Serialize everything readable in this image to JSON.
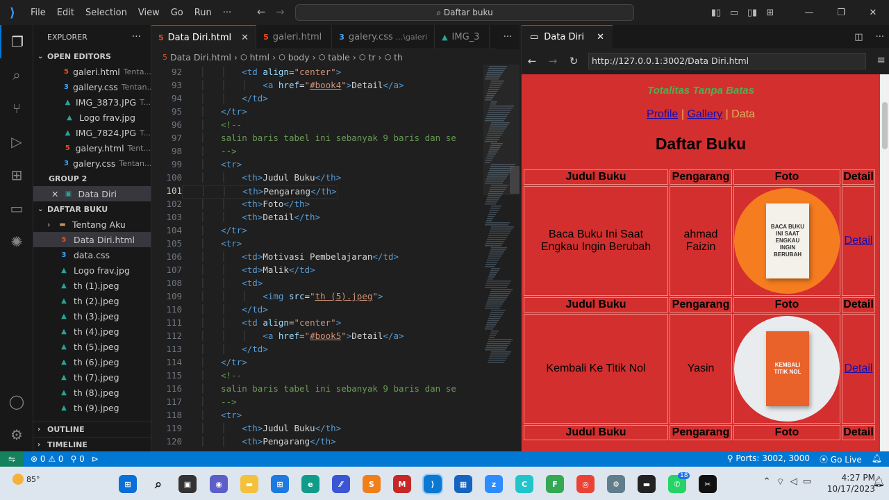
{
  "titlebar": {
    "menu": [
      "File",
      "Edit",
      "Selection",
      "View",
      "Go",
      "Run",
      "···"
    ],
    "search": "Daftar buku"
  },
  "sidebar": {
    "header": "EXPLORER",
    "open_editors_title": "OPEN EDITORS",
    "open_editors": [
      {
        "name": "galeri.html",
        "desc": "Tenta...",
        "type": "html"
      },
      {
        "name": "gallery.css",
        "desc": "Tentan...",
        "type": "css"
      },
      {
        "name": "IMG_3873.JPG",
        "desc": "T...",
        "type": "img"
      },
      {
        "name": "Logo frav.jpg",
        "desc": "",
        "type": "img"
      },
      {
        "name": "IMG_7824.JPG",
        "desc": "T...",
        "type": "img"
      },
      {
        "name": "galery.html",
        "desc": "Tent...",
        "type": "html"
      },
      {
        "name": "galery.css",
        "desc": "Tentan...",
        "type": "css"
      }
    ],
    "group2_title": "GROUP 2",
    "group2_item": "Data Diri",
    "folder_title": "DAFTAR BUKU",
    "folder_items": [
      {
        "name": "Tentang Aku",
        "type": "fold"
      },
      {
        "name": "Data Diri.html",
        "type": "html"
      },
      {
        "name": "data.css",
        "type": "css"
      },
      {
        "name": "Logo frav.jpg",
        "type": "img"
      },
      {
        "name": "th (1).jpeg",
        "type": "img"
      },
      {
        "name": "th (2).jpeg",
        "type": "img"
      },
      {
        "name": "th (3).jpeg",
        "type": "img"
      },
      {
        "name": "th (4).jpeg",
        "type": "img"
      },
      {
        "name": "th (5).jpeg",
        "type": "img"
      },
      {
        "name": "th (6).jpeg",
        "type": "img"
      },
      {
        "name": "th (7).jpeg",
        "type": "img"
      },
      {
        "name": "th (8).jpeg",
        "type": "img"
      },
      {
        "name": "th (9).jpeg",
        "type": "img"
      }
    ],
    "outline": "OUTLINE",
    "timeline": "TIMELINE"
  },
  "editor": {
    "tabs": [
      {
        "label": "Data Diri.html",
        "desc": "",
        "type": "html"
      },
      {
        "label": "galeri.html",
        "desc": "",
        "type": "html"
      },
      {
        "label": "galery.css",
        "desc": "...\\galeri",
        "type": "css"
      },
      {
        "label": "IMG_3",
        "desc": "",
        "type": "img"
      }
    ],
    "breadcrumb": [
      "Data Diri.html",
      "html",
      "body",
      "table",
      "tr",
      "th"
    ],
    "lines": [
      {
        "n": "92",
        "ind": 2,
        "html": "<span class='tg'>&lt;td</span> <span class='at'>align</span><span class='tx'>=</span><span class='st'>\"center\"</span><span class='tg'>&gt;</span>"
      },
      {
        "n": "93",
        "ind": 3,
        "html": "<span class='tg'>&lt;a</span> <span class='at'>href</span><span class='tx'>=</span><span class='st'>\"<u>#book4</u>\"</span><span class='tg'>&gt;</span><span class='tx'>Detail</span><span class='tg'>&lt;/a&gt;</span>"
      },
      {
        "n": "94",
        "ind": 2,
        "html": "<span class='tg'>&lt;/td&gt;</span>"
      },
      {
        "n": "95",
        "ind": 1,
        "html": "<span class='tg'>&lt;/tr&gt;</span>"
      },
      {
        "n": "96",
        "ind": 1,
        "html": "<span class='cm'>&lt;!--</span>"
      },
      {
        "n": "97",
        "ind": 1,
        "html": "<span class='cm'>salin baris tabel ini sebanyak 9 baris dan se</span>"
      },
      {
        "n": "98",
        "ind": 1,
        "html": "<span class='cm'>--&gt;</span>"
      },
      {
        "n": "99",
        "ind": 1,
        "html": "<span class='tg'>&lt;tr&gt;</span>"
      },
      {
        "n": "100",
        "ind": 2,
        "html": "<span class='tg'>&lt;th&gt;</span><span class='tx'>Judul Buku</span><span class='tg'>&lt;/th&gt;</span>"
      },
      {
        "n": "101",
        "ind": 2,
        "html": "<span class='tg'>&lt;th&gt;</span><span class='tx'>Pengarang</span><span class='tg'>&lt;/th&gt;</span>",
        "cur": true
      },
      {
        "n": "102",
        "ind": 2,
        "html": "<span class='tg'>&lt;th&gt;</span><span class='tx'>Foto</span><span class='tg'>&lt;/th&gt;</span>"
      },
      {
        "n": "103",
        "ind": 2,
        "html": "<span class='tg'>&lt;th&gt;</span><span class='tx'>Detail</span><span class='tg'>&lt;/th&gt;</span>"
      },
      {
        "n": "104",
        "ind": 1,
        "html": "<span class='tg'>&lt;/tr&gt;</span>"
      },
      {
        "n": "105",
        "ind": 1,
        "html": "<span class='tg'>&lt;tr&gt;</span>"
      },
      {
        "n": "106",
        "ind": 2,
        "html": "<span class='tg'>&lt;td&gt;</span><span class='tx'>Motivasi Pembelajaran</span><span class='tg'>&lt;/td&gt;</span>"
      },
      {
        "n": "107",
        "ind": 2,
        "html": "<span class='tg'>&lt;td&gt;</span><span class='tx'>Malik</span><span class='tg'>&lt;/td&gt;</span>"
      },
      {
        "n": "108",
        "ind": 2,
        "html": "<span class='tg'>&lt;td&gt;</span>"
      },
      {
        "n": "109",
        "ind": 3,
        "html": "<span class='tg'>&lt;img</span> <span class='at'>src</span><span class='tx'>=</span><span class='st'>\"<u>th (5).jpeg</u>\"</span><span class='tg'>&gt;</span>"
      },
      {
        "n": "110",
        "ind": 2,
        "html": "<span class='tg'>&lt;/td&gt;</span>"
      },
      {
        "n": "111",
        "ind": 2,
        "html": "<span class='tg'>&lt;td</span> <span class='at'>align</span><span class='tx'>=</span><span class='st'>\"center\"</span><span class='tg'>&gt;</span>"
      },
      {
        "n": "112",
        "ind": 3,
        "html": "<span class='tg'>&lt;a</span> <span class='at'>href</span><span class='tx'>=</span><span class='st'>\"<u>#book5</u>\"</span><span class='tg'>&gt;</span><span class='tx'>Detail</span><span class='tg'>&lt;/a&gt;</span>"
      },
      {
        "n": "113",
        "ind": 2,
        "html": "<span class='tg'>&lt;/td&gt;</span>"
      },
      {
        "n": "114",
        "ind": 1,
        "html": "<span class='tg'>&lt;/tr&gt;</span>"
      },
      {
        "n": "115",
        "ind": 1,
        "html": "<span class='cm'>&lt;!--</span>"
      },
      {
        "n": "116",
        "ind": 1,
        "html": "<span class='cm'>salin baris tabel ini sebanyak 9 baris dan se</span>"
      },
      {
        "n": "117",
        "ind": 1,
        "html": "<span class='cm'>--&gt;</span>"
      },
      {
        "n": "118",
        "ind": 1,
        "html": "<span class='tg'>&lt;tr&gt;</span>"
      },
      {
        "n": "119",
        "ind": 2,
        "html": "<span class='tg'>&lt;th&gt;</span><span class='tx'>Judul Buku</span><span class='tg'>&lt;/th&gt;</span>"
      },
      {
        "n": "120",
        "ind": 2,
        "html": "<span class='tg'>&lt;th&gt;</span><span class='tx'>Pengarang</span><span class='tg'>&lt;/th&gt;</span>"
      }
    ]
  },
  "preview": {
    "tab_label": "Data Diri",
    "url": "http://127.0.0.1:3002/Data Diri.html",
    "page": {
      "tagline": "Totalitas Tanpa Batas",
      "nav": {
        "profile": "Profile",
        "sep1": " | ",
        "gallery": "Gallery",
        "sep2": " | ",
        "data": "Data"
      },
      "title": "Daftar Buku",
      "headers": [
        "Judul Buku",
        "Pengarang",
        "Foto",
        "Detail"
      ],
      "rows": [
        {
          "title": "Baca Buku Ini Saat Engkau Ingin Berubah",
          "author": "ahmad Faizin",
          "cover_text": "BACA BUKU INI SAAT ENGKAU INGIN BERUBAH",
          "detail": "Detail",
          "bg": "#f57c1f",
          "cover": "#f4f1ea"
        },
        {
          "title": "Kembali Ke Titik Nol",
          "author": "Yasin",
          "cover_text": "KEMBALI TITIK NOL",
          "detail": "Detail",
          "bg": "#e9ecef",
          "cover": "#e8622a"
        }
      ]
    }
  },
  "statusbar": {
    "errors": "0",
    "warnings": "0",
    "ports_count": "0",
    "ports": "Ports: 3002, 3000",
    "golive": "Go Live"
  },
  "taskbar": {
    "temp": "85°",
    "time": "4:27 PM",
    "date": "10/17/2023",
    "whatsapp_badge": "18"
  }
}
